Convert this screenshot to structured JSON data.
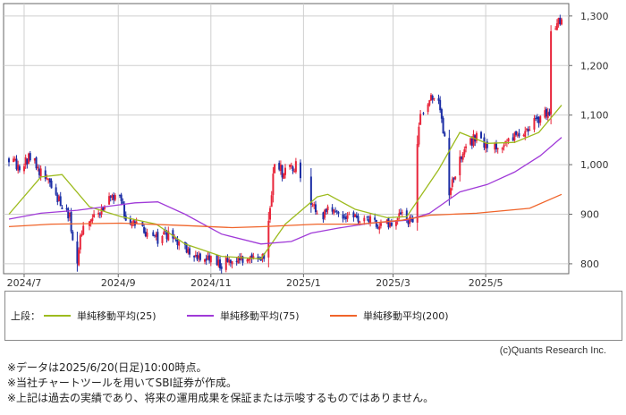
{
  "chart_data": {
    "type": "candlestick",
    "x_ticks": [
      "2024/7",
      "2024/9",
      "2024/11",
      "2025/1",
      "2025/3",
      "2025/5"
    ],
    "y_ticks": [
      "800",
      "900",
      "1,000",
      "1,100",
      "1,200",
      "1,300"
    ],
    "ylim": [
      780,
      1325
    ],
    "grid": true,
    "x_start": "2024-06-21",
    "x_end": "2025-06-20",
    "price_path": [
      [
        "2024-06-21",
        1010
      ],
      [
        "2024-06-28",
        995
      ],
      [
        "2024-07-05",
        1015
      ],
      [
        "2024-07-12",
        985
      ],
      [
        "2024-07-19",
        955
      ],
      [
        "2024-07-26",
        920
      ],
      [
        "2024-07-31",
        895
      ],
      [
        "2024-08-05",
        790
      ],
      [
        "2024-08-07",
        865
      ],
      [
        "2024-08-13",
        885
      ],
      [
        "2024-08-20",
        910
      ],
      [
        "2024-08-27",
        930
      ],
      [
        "2024-09-03",
        930
      ],
      [
        "2024-09-06",
        880
      ],
      [
        "2024-09-12",
        880
      ],
      [
        "2024-09-19",
        860
      ],
      [
        "2024-09-27",
        850
      ],
      [
        "2024-10-04",
        860
      ],
      [
        "2024-10-11",
        835
      ],
      [
        "2024-10-18",
        825
      ],
      [
        "2024-10-25",
        815
      ],
      [
        "2024-11-01",
        810
      ],
      [
        "2024-11-08",
        800
      ],
      [
        "2024-11-15",
        805
      ],
      [
        "2024-11-22",
        810
      ],
      [
        "2024-11-29",
        818
      ],
      [
        "2024-12-06",
        815
      ],
      [
        "2024-12-10",
        905
      ],
      [
        "2024-12-13",
        1010
      ],
      [
        "2024-12-18",
        985
      ],
      [
        "2024-12-24",
        990
      ],
      [
        "2024-12-27",
        1000
      ],
      [
        "2025-01-06",
        925
      ],
      [
        "2025-01-10",
        895
      ],
      [
        "2025-01-17",
        905
      ],
      [
        "2025-01-24",
        905
      ],
      [
        "2025-01-31",
        895
      ],
      [
        "2025-02-07",
        895
      ],
      [
        "2025-02-14",
        890
      ],
      [
        "2025-02-21",
        875
      ],
      [
        "2025-02-28",
        885
      ],
      [
        "2025-03-07",
        905
      ],
      [
        "2025-03-10",
        890
      ],
      [
        "2025-03-14",
        880
      ],
      [
        "2025-03-18",
        1085
      ],
      [
        "2025-03-25",
        1135
      ],
      [
        "2025-03-31",
        1130
      ],
      [
        "2025-04-04",
        1050
      ],
      [
        "2025-04-07",
        935
      ],
      [
        "2025-04-11",
        985
      ],
      [
        "2025-04-18",
        1040
      ],
      [
        "2025-04-25",
        1055
      ],
      [
        "2025-05-02",
        1035
      ],
      [
        "2025-05-09",
        1040
      ],
      [
        "2025-05-16",
        1050
      ],
      [
        "2025-05-23",
        1060
      ],
      [
        "2025-05-30",
        1075
      ],
      [
        "2025-06-06",
        1095
      ],
      [
        "2025-06-12",
        1110
      ],
      [
        "2025-06-13",
        1280
      ],
      [
        "2025-06-20",
        1290
      ]
    ],
    "series": [
      {
        "name": "単純移動平均(25)",
        "color": "#9dbb1e",
        "points": [
          [
            "2024-06-21",
            900
          ],
          [
            "2024-07-12",
            975
          ],
          [
            "2024-07-26",
            980
          ],
          [
            "2024-08-13",
            915
          ],
          [
            "2024-09-03",
            895
          ],
          [
            "2024-09-26",
            880
          ],
          [
            "2024-10-15",
            840
          ],
          [
            "2024-11-08",
            815
          ],
          [
            "2024-12-04",
            810
          ],
          [
            "2024-12-20",
            880
          ],
          [
            "2025-01-10",
            935
          ],
          [
            "2025-01-17",
            940
          ],
          [
            "2025-02-04",
            910
          ],
          [
            "2025-02-25",
            893
          ],
          [
            "2025-03-10",
            895
          ],
          [
            "2025-03-31",
            990
          ],
          [
            "2025-04-14",
            1065
          ],
          [
            "2025-05-02",
            1043
          ],
          [
            "2025-05-20",
            1045
          ],
          [
            "2025-06-05",
            1065
          ],
          [
            "2025-06-20",
            1120
          ]
        ]
      },
      {
        "name": "単純移動平均(75)",
        "color": "#a03ad8",
        "points": [
          [
            "2024-06-21",
            890
          ],
          [
            "2024-07-12",
            902
          ],
          [
            "2024-08-05",
            908
          ],
          [
            "2024-09-12",
            923
          ],
          [
            "2024-09-27",
            925
          ],
          [
            "2024-10-15",
            900
          ],
          [
            "2024-11-08",
            860
          ],
          [
            "2024-12-04",
            840
          ],
          [
            "2024-12-24",
            845
          ],
          [
            "2025-01-06",
            862
          ],
          [
            "2025-01-24",
            872
          ],
          [
            "2025-02-14",
            882
          ],
          [
            "2025-03-10",
            888
          ],
          [
            "2025-03-25",
            902
          ],
          [
            "2025-04-14",
            945
          ],
          [
            "2025-05-02",
            960
          ],
          [
            "2025-05-20",
            985
          ],
          [
            "2025-06-06",
            1018
          ],
          [
            "2025-06-20",
            1055
          ]
        ]
      },
      {
        "name": "単純移動平均(200)",
        "color": "#f0642a",
        "points": [
          [
            "2024-06-21",
            875
          ],
          [
            "2024-07-19",
            880
          ],
          [
            "2024-09-03",
            882
          ],
          [
            "2024-10-15",
            877
          ],
          [
            "2024-11-15",
            873
          ],
          [
            "2024-12-06",
            875
          ],
          [
            "2025-01-10",
            880
          ],
          [
            "2025-02-07",
            880
          ],
          [
            "2025-03-07",
            888
          ],
          [
            "2025-03-25",
            898
          ],
          [
            "2025-04-25",
            902
          ],
          [
            "2025-05-30",
            912
          ],
          [
            "2025-06-20",
            940
          ]
        ]
      }
    ]
  },
  "legend": {
    "prefix": "上段：",
    "items": [
      {
        "label": "単純移動平均(25)",
        "color": "#9dbb1e"
      },
      {
        "label": "単純移動平均(75)",
        "color": "#a03ad8"
      },
      {
        "label": "単純移動平均(200)",
        "color": "#f0642a"
      }
    ]
  },
  "credit": "(c)Quants Research Inc.",
  "notes": [
    "※データは2025/6/20(日足)10:00時点。",
    "※当社チャートツールを用いてSBI証券が作成。",
    "※上記は過去の実績であり、将来の運用成果を保証または示唆するものではありません。"
  ],
  "colors": {
    "up": "#e8253a",
    "down": "#1c2ea5",
    "grid": "#cfcfcf",
    "frame": "#666666"
  }
}
